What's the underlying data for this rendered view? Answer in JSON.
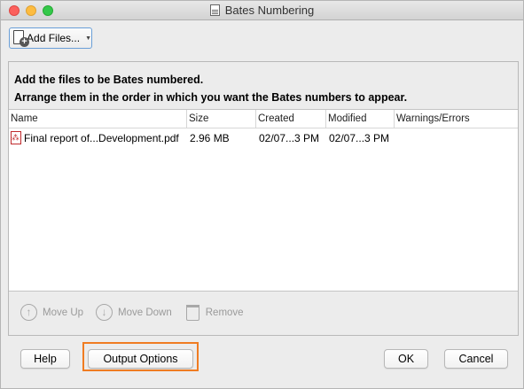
{
  "window": {
    "title": "Bates Numbering"
  },
  "toolbar": {
    "add_files_label": "Add Files..."
  },
  "instructions": {
    "line1": "Add the files to be Bates numbered.",
    "line2": "Arrange them in the order in which you want the Bates numbers to appear."
  },
  "table": {
    "headers": {
      "name": "Name",
      "size": "Size",
      "created": "Created",
      "modified": "Modified",
      "warnings": "Warnings/Errors"
    },
    "rows": [
      {
        "name": "Final report  of...Development.pdf",
        "size": "2.96 MB",
        "created": "02/07...3 PM",
        "modified": "02/07...3 PM",
        "warnings": ""
      }
    ]
  },
  "row_actions": {
    "move_up": "Move Up",
    "move_down": "Move Down",
    "remove": "Remove"
  },
  "buttons": {
    "help": "Help",
    "output_options": "Output Options",
    "ok": "OK",
    "cancel": "Cancel"
  },
  "colors": {
    "highlight": "#f07c22",
    "pdf_red": "#c0292b"
  }
}
